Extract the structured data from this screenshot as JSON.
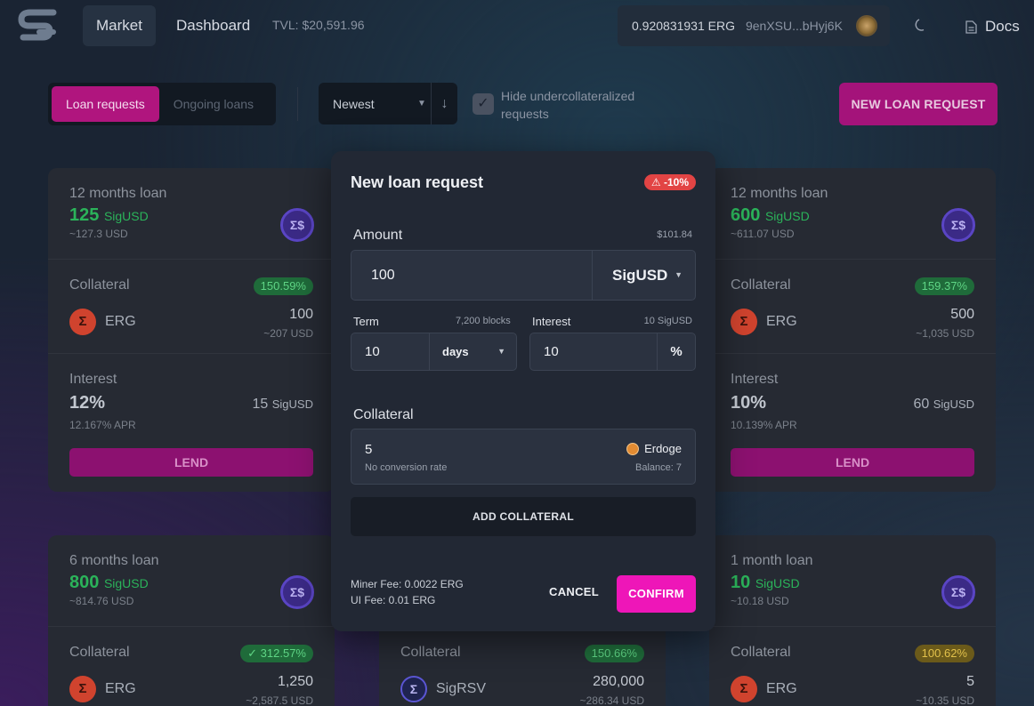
{
  "header": {
    "nav": {
      "market": "Market",
      "dashboard": "Dashboard"
    },
    "tvl": "TVL: $20,591.96",
    "wallet": {
      "balance": "0.920831931 ERG",
      "address": "9enXSU...bHyj6K"
    },
    "docs": "Docs",
    "theme_icon": "moon-icon"
  },
  "toolbar": {
    "tabs": [
      "Loan requests",
      "Ongoing loans"
    ],
    "active_tab": "Loan requests",
    "sort_label": "Newest",
    "hide_label": "Hide undercollateralized requests",
    "hide_checked": true,
    "new_loan_button": "NEW LOAN REQUEST"
  },
  "labels": {
    "collateral": "Collateral",
    "interest": "Interest",
    "lend": "LEND"
  },
  "cards": [
    {
      "term": "12 months loan",
      "amount": "125",
      "currency": "SigUSD",
      "usd": "~127.3 USD",
      "ratio": "150.59%",
      "ratio_color": "green",
      "coll_token": "ERG",
      "coll_amount": "100",
      "coll_usd": "~207 USD",
      "interest_pct": "12%",
      "apr": "12.167% APR",
      "interest_value": "15",
      "interest_currency": "SigUSD"
    },
    {
      "term": "12 months loan",
      "amount": "600",
      "currency": "SigUSD",
      "usd": "~611.07 USD",
      "ratio": "159.37%",
      "ratio_color": "green",
      "coll_token": "ERG",
      "coll_amount": "500",
      "coll_usd": "~1,035 USD",
      "interest_pct": "10%",
      "apr": "10.139% APR",
      "interest_value": "60",
      "interest_currency": "SigUSD"
    },
    {
      "term": "6 months loan",
      "amount": "800",
      "currency": "SigUSD",
      "usd": "~814.76 USD",
      "ratio": "312.57%",
      "ratio_color": "green",
      "coll_token": "ERG",
      "coll_amount": "1,250",
      "coll_usd": "~2,587.5 USD"
    },
    {
      "ratio": "150.66%",
      "ratio_color": "green",
      "coll_token": "SigRSV",
      "coll_amount": "280,000",
      "coll_usd": "~286.34 USD"
    },
    {
      "term": "1 month loan",
      "amount": "10",
      "currency": "SigUSD",
      "usd": "~10.18 USD",
      "ratio": "100.62%",
      "ratio_color": "yellow",
      "coll_token": "ERG",
      "coll_amount": "5",
      "coll_usd": "~10.35 USD"
    }
  ],
  "modal": {
    "title": "New loan request",
    "warning": "-10%",
    "amount_label": "Amount",
    "amount_usd": "$101.84",
    "amount_value": "100",
    "amount_currency": "SigUSD",
    "term_label": "Term",
    "term_blocks": "7,200 blocks",
    "term_value": "10",
    "term_unit": "days",
    "interest_label": "Interest",
    "interest_sig": "10 SigUSD",
    "interest_value": "10",
    "interest_unit": "%",
    "collateral_label": "Collateral",
    "collateral_value": "5",
    "collateral_token": "Erdoge",
    "conversion": "No conversion rate",
    "balance": "Balance: 7",
    "add_collateral": "ADD COLLATERAL",
    "miner_fee": "Miner Fee: 0.0022 ERG",
    "ui_fee": "UI Fee: 0.01 ERG",
    "cancel": "CANCEL",
    "confirm": "CONFIRM"
  }
}
